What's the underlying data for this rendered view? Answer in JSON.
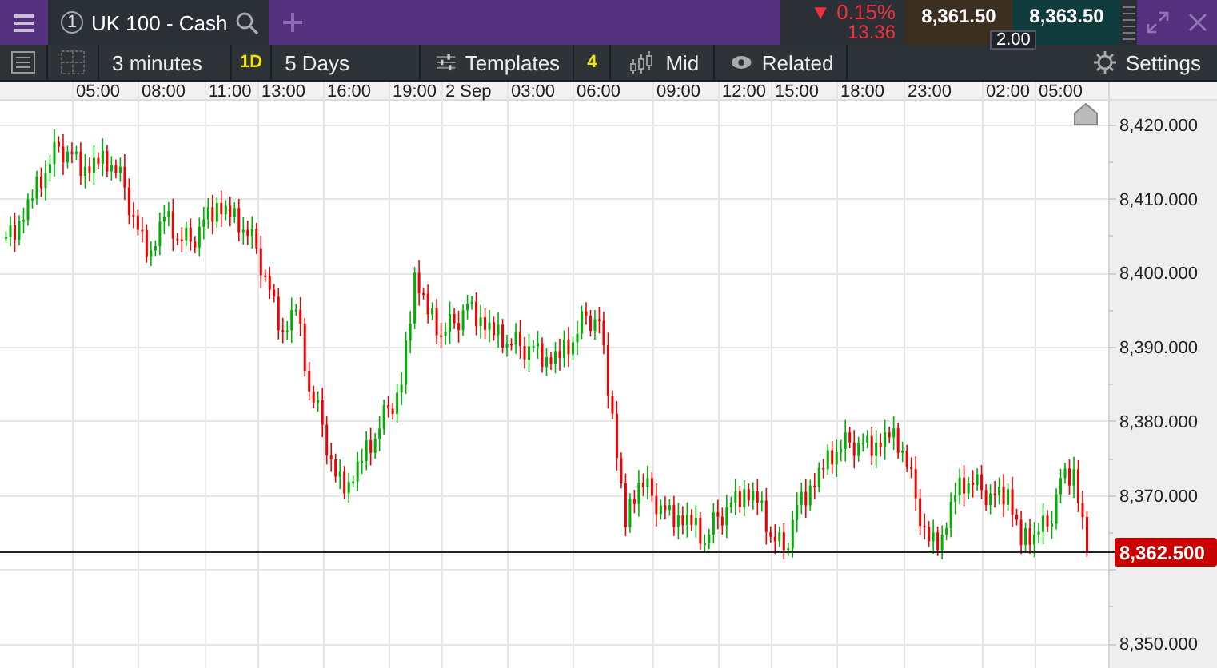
{
  "top_bar": {
    "tab": {
      "number": "1",
      "title": "UK 100 - Cash"
    },
    "change": {
      "percent": "▼ 0.15%",
      "points": "13.36"
    },
    "sell": "8,361.50",
    "buy": "8,363.50",
    "spread": "2.00"
  },
  "toolbar": {
    "interval": "3 minutes",
    "range_badge": "1D",
    "range": "5 Days",
    "templates": "Templates",
    "indicator_count": "4",
    "price_type": "Mid",
    "related": "Related",
    "settings": "Settings"
  },
  "chart": {
    "time_labels": [
      "05:00",
      "08:00",
      "11:00",
      "13:00",
      "16:00",
      "19:00",
      "2 Sep",
      "03:00",
      "06:00",
      "09:00",
      "12:00",
      "15:00",
      "18:00",
      "23:00",
      "02:00",
      "05:00"
    ],
    "price_labels": [
      "8,420.000",
      "8,410.000",
      "8,400.000",
      "8,390.000",
      "8,380.000",
      "8,370.000",
      "8,350.000"
    ],
    "current_price": "8,362.500"
  }
}
